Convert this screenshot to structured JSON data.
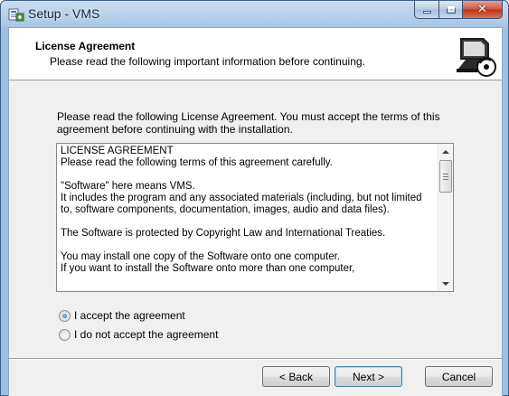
{
  "window": {
    "title": "Setup - VMS",
    "icon": "setup-installer-icon"
  },
  "caption_buttons": {
    "minimize": "minimize-icon",
    "maximize": "maximize-icon",
    "close": "close-icon"
  },
  "header": {
    "title": "License Agreement",
    "subtitle": "Please read the following important information before continuing.",
    "image": "computer-install-icon"
  },
  "intro": {
    "text": "Please read the following License Agreement. You must accept the terms of this agreement before continuing with the installation."
  },
  "license": {
    "lines": [
      "LICENSE AGREEMENT",
      "Please read the following terms of this agreement carefully.",
      "",
      "\"Software\" here means VMS.",
      "It includes the program and any associated materials (including, but not limited to, software components, documentation, images, audio and data files).",
      "",
      "The Software is protected by Copyright Law  and International Treaties.",
      "",
      "You may install one copy of the Software onto one computer.",
      "If you want to install the Software onto more than one computer,"
    ]
  },
  "options": {
    "accept_label": "I accept the agreement",
    "decline_label": "I do not accept the agreement",
    "selected": "accept"
  },
  "buttons": {
    "back": "< Back",
    "next": "Next >",
    "cancel": "Cancel"
  },
  "colors": {
    "titlebar": "#a9c6e6",
    "close_button": "#c0331a",
    "dialog_bg": "#f0f0f0",
    "default_button_border": "#3c7fb1"
  }
}
